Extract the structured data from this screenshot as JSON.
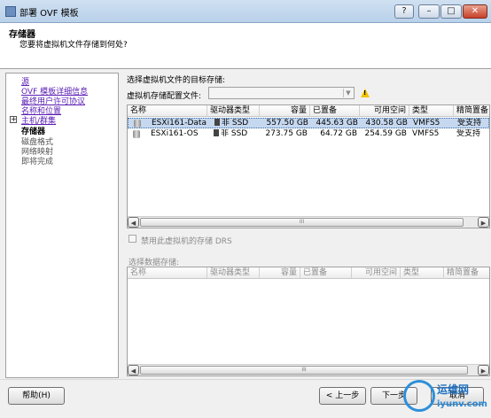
{
  "window": {
    "title": "部署 OVF 模板",
    "controls": [
      "?",
      "–",
      "□",
      "✕"
    ]
  },
  "header": {
    "title": "存储器",
    "subtitle": "您要将虚拟机文件存储到何处?"
  },
  "nav": {
    "items": [
      {
        "label": "源"
      },
      {
        "label": "OVF 模板详细信息"
      },
      {
        "label": "最终用户许可协议"
      },
      {
        "label": "名称和位置"
      },
      {
        "label": "主机/群集"
      },
      {
        "label": "存储器"
      },
      {
        "label": "磁盘格式"
      },
      {
        "label": "网络映射"
      },
      {
        "label": "即将完成"
      }
    ]
  },
  "main": {
    "select_label": "选择虚拟机文件的目标存储:",
    "profile_label": "虚拟机存储配置文件:",
    "profile_value": "",
    "warning_icon": "warning-icon",
    "columns": [
      "名称",
      "驱动器类型",
      "容量",
      "已置备",
      "可用空间",
      "类型",
      "精简置备"
    ],
    "rows": [
      {
        "name": "ESXi161-Data",
        "drive": "非 SSD",
        "capacity": "557.50 GB",
        "provisioned": "445.63 GB",
        "free": "430.58 GB",
        "type": "VMFS5",
        "thin": "受支持"
      },
      {
        "name": "ESXi161-OS",
        "drive": "非 SSD",
        "capacity": "273.75 GB",
        "provisioned": "64.72 GB",
        "free": "254.59 GB",
        "type": "VMFS5",
        "thin": "受支持"
      }
    ],
    "disable_drs_label": "禁用此虚拟机的存储 DRS",
    "datastore_label": "选择数据存储:",
    "columns2": [
      "名称",
      "驱动器类型",
      "容量",
      "已置备",
      "可用空间",
      "类型",
      "精简置备"
    ]
  },
  "footer": {
    "help": "帮助(H)",
    "back": "< 上一步",
    "next": "下一步",
    "cancel": "取消"
  },
  "watermark": {
    "brand": "运维网",
    "site": "iyunv.com"
  },
  "scroll_thumb": "III"
}
